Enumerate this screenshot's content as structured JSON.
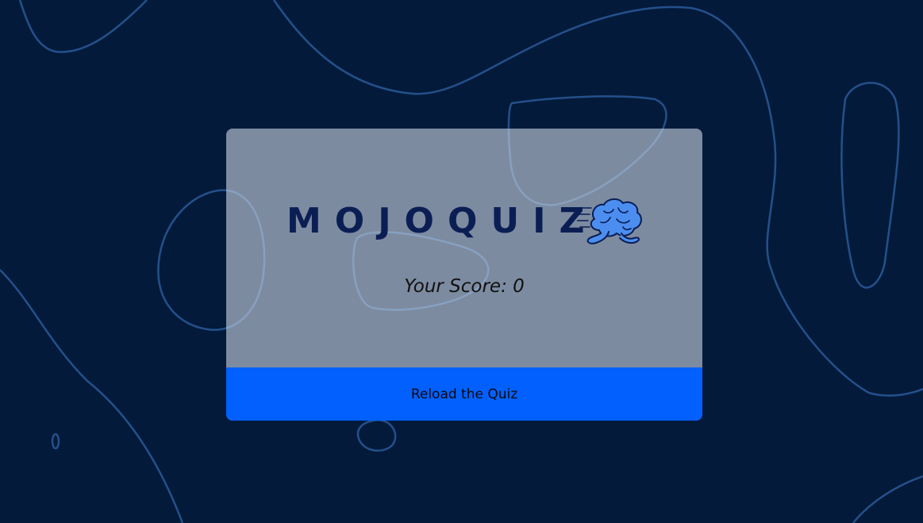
{
  "app": {
    "logo_text": "MOJOQUIZ",
    "logo_icon": "running-brain-icon"
  },
  "result": {
    "score_text": "Your Score: 0"
  },
  "actions": {
    "reload_label": "Reload the Quiz"
  },
  "colors": {
    "background": "#041a3a",
    "contour_lines": "#2a5a9a",
    "card": "#c6d2de",
    "logo_text": "#0b1e54",
    "button": "#0260ff",
    "brain_fill": "#4c8ef0"
  }
}
